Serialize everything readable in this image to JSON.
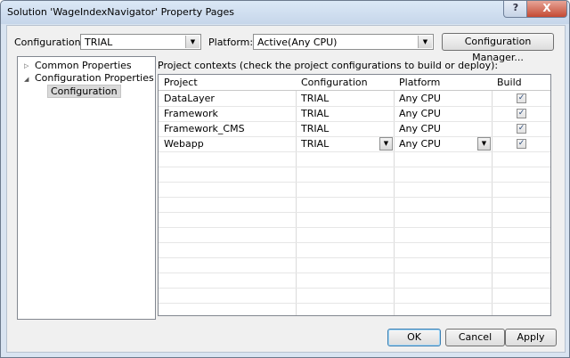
{
  "window": {
    "title": "Solution 'WageIndexNavigator' Property Pages",
    "help_glyph": "?",
    "close_glyph": "X"
  },
  "toolbar": {
    "configuration_label": "Configuration:",
    "configuration_value": "TRIAL",
    "platform_label": "Platform:",
    "platform_value": "Active(Any CPU)",
    "config_manager_label": "Configuration Manager..."
  },
  "tree": {
    "items": [
      {
        "label": "Common Properties",
        "expanded": false
      },
      {
        "label": "Configuration Properties",
        "expanded": true
      },
      {
        "label": "Configuration",
        "selected": true
      }
    ]
  },
  "grid": {
    "caption": "Project contexts (check the project configurations to build or deploy):",
    "columns": [
      "Project",
      "Configuration",
      "Platform",
      "Build"
    ],
    "rows": [
      {
        "project": "DataLayer",
        "configuration": "TRIAL",
        "platform": "Any CPU",
        "build": true
      },
      {
        "project": "Framework",
        "configuration": "TRIAL",
        "platform": "Any CPU",
        "build": true
      },
      {
        "project": "Framework_CMS",
        "configuration": "TRIAL",
        "platform": "Any CPU",
        "build": true
      },
      {
        "project": "Webapp",
        "configuration": "TRIAL",
        "platform": "Any CPU",
        "build": true
      }
    ]
  },
  "footer": {
    "ok_label": "OK",
    "cancel_label": "Cancel",
    "apply_label": "Apply"
  }
}
